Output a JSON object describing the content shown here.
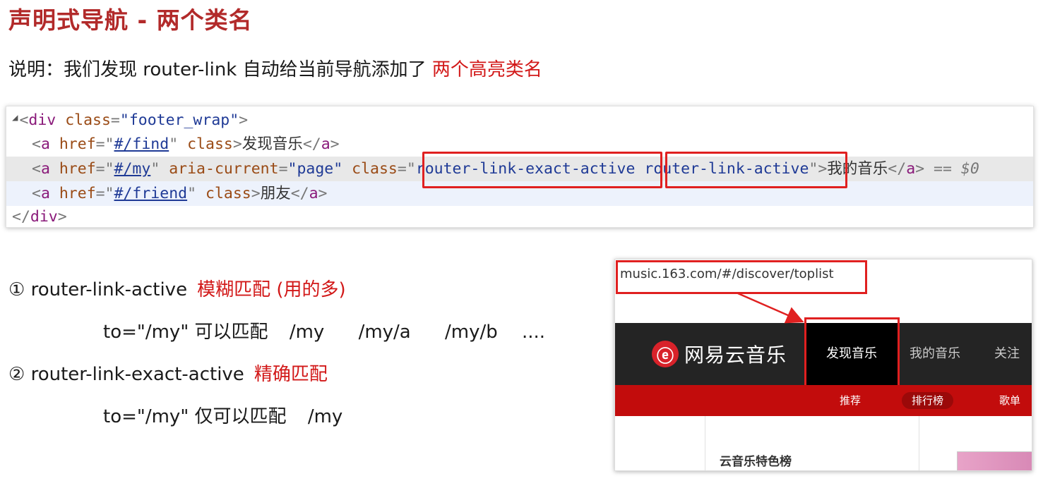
{
  "title": "声明式导航 - 两个类名",
  "description": {
    "prefix": "说明：我们发现 router-link 自动给当前导航添加了",
    "highlight": "两个高亮类名"
  },
  "code": {
    "line1_tag": "div",
    "line1_attr": "class",
    "line1_val": "\"footer_wrap\"",
    "line2_attr": "href",
    "line2_href": "#/find",
    "line2_attr2": "class",
    "line2_text": "发现音乐",
    "line3_attr": "href",
    "line3_href": "#/my",
    "line3_attr2": "aria-current",
    "line3_val2": "\"page\"",
    "line3_attr3": "class",
    "line3_class1": "router-link-exact-active",
    "line3_class2": "router-link-active",
    "line3_text": "我的音乐",
    "line3_suffix": "== $0",
    "line4_attr": "href",
    "line4_href": "#/friend",
    "line4_attr2": "class",
    "line4_text": "朋友",
    "tag_a": "a"
  },
  "items": {
    "one_label": "① router-link-active",
    "one_note": "模糊匹配 (用的多)",
    "one_example_lead": "to=\"/my\"  可以匹配",
    "one_ex1": "/my",
    "one_ex2": "/my/a",
    "one_ex3": "/my/b",
    "one_ex4": "....",
    "two_label": "② router-link-exact-active",
    "two_note": "精确匹配",
    "two_example_lead": "to=\"/my\"  仅可以匹配",
    "two_ex1": "/my"
  },
  "screenshot": {
    "url": "music.163.com/#/discover/toplist",
    "logo_glyph": "ⓔ",
    "logo_text": "网易云音乐",
    "nav": [
      "发现音乐",
      "我的音乐",
      "关注"
    ],
    "sub": [
      "推荐",
      "排行榜",
      "歌单"
    ],
    "side_title": "云音乐特色榜"
  },
  "colors": {
    "title": "#b22a2a",
    "highlight": "#d21818",
    "box": "#e02020",
    "topbar": "#242424",
    "subbar": "#c20c0c"
  }
}
